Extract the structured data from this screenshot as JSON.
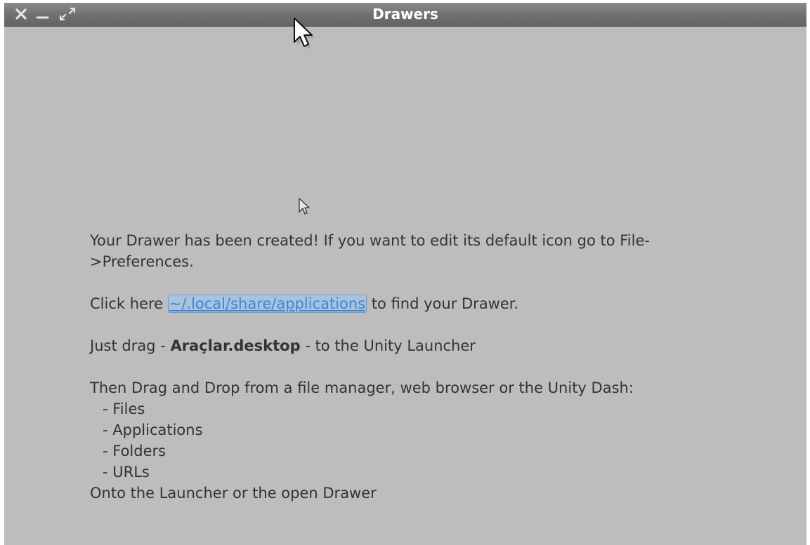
{
  "window": {
    "title": "Drawers"
  },
  "controls": {
    "close_icon": "close-icon",
    "minimize_icon": "minimize-icon",
    "maximize_icon": "maximize-icon"
  },
  "content": {
    "line1": "Your Drawer has been created! If you want to edit its default icon go to File-",
    "line2": ">Preferences.",
    "click_prefix": "Click here ",
    "link_text": "~/.local/share/applications",
    "click_suffix": " to find your Drawer.",
    "drag_prefix": "Just drag - ",
    "drag_file": "Araçlar.desktop",
    "drag_suffix": " - to the Unity Launcher",
    "dnd_intro": "Then Drag and Drop from a file manager, web browser or the Unity Dash:",
    "items": [
      "- Files",
      "- Applications",
      "- Folders",
      "- URLs"
    ],
    "outro": "Onto the Launcher or the open Drawer"
  },
  "colors": {
    "window_bg": "#bdbdbd",
    "titlebar": "#6f6f6f",
    "link": "#3d87d6"
  }
}
